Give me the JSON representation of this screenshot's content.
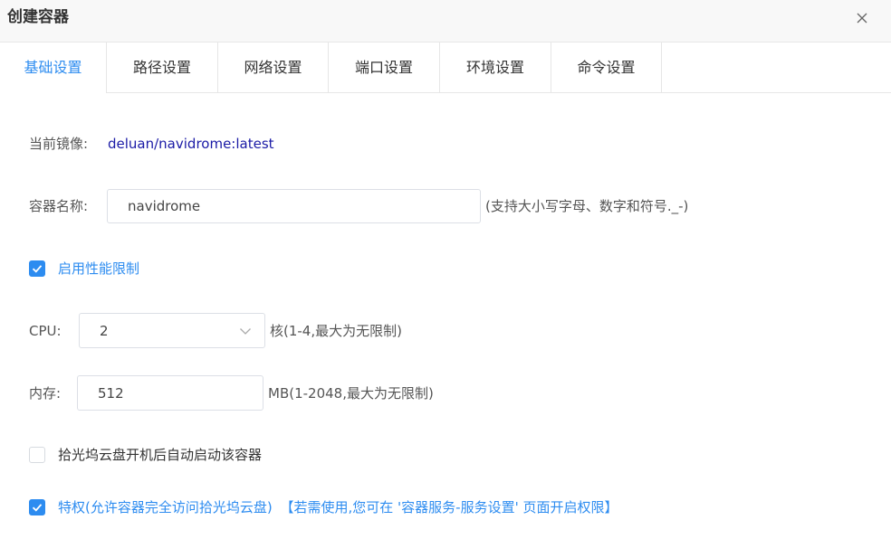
{
  "dialog": {
    "title": "创建容器"
  },
  "tabs": [
    {
      "label": "基础设置",
      "active": true
    },
    {
      "label": "路径设置",
      "active": false
    },
    {
      "label": "网络设置",
      "active": false
    },
    {
      "label": "端口设置",
      "active": false
    },
    {
      "label": "环境设置",
      "active": false
    },
    {
      "label": "命令设置",
      "active": false
    }
  ],
  "image": {
    "label": "当前镜像:",
    "value": "deluan/navidrome:latest"
  },
  "name": {
    "label": "容器名称:",
    "value": "navidrome",
    "hint": "(支持大小写字母、数字和符号._-)"
  },
  "perf_limit": {
    "label": "启用性能限制",
    "checked": true
  },
  "cpu": {
    "label": "CPU:",
    "value": "2",
    "hint": "核(1-4,最大为无限制)"
  },
  "memory": {
    "label": "内存:",
    "value": "512",
    "hint": "MB(1-2048,最大为无限制)"
  },
  "autostart": {
    "label": "拾光坞云盘开机后自动启动该容器",
    "checked": false
  },
  "privileged": {
    "label": "特权(允许容器完全访问拾光坞云盘)",
    "note": "【若需使用,您可在 '容器服务-服务设置' 页面开启权限】",
    "checked": true
  },
  "colors": {
    "accent": "#2d8cf0",
    "image_link": "#1a1aa6"
  }
}
